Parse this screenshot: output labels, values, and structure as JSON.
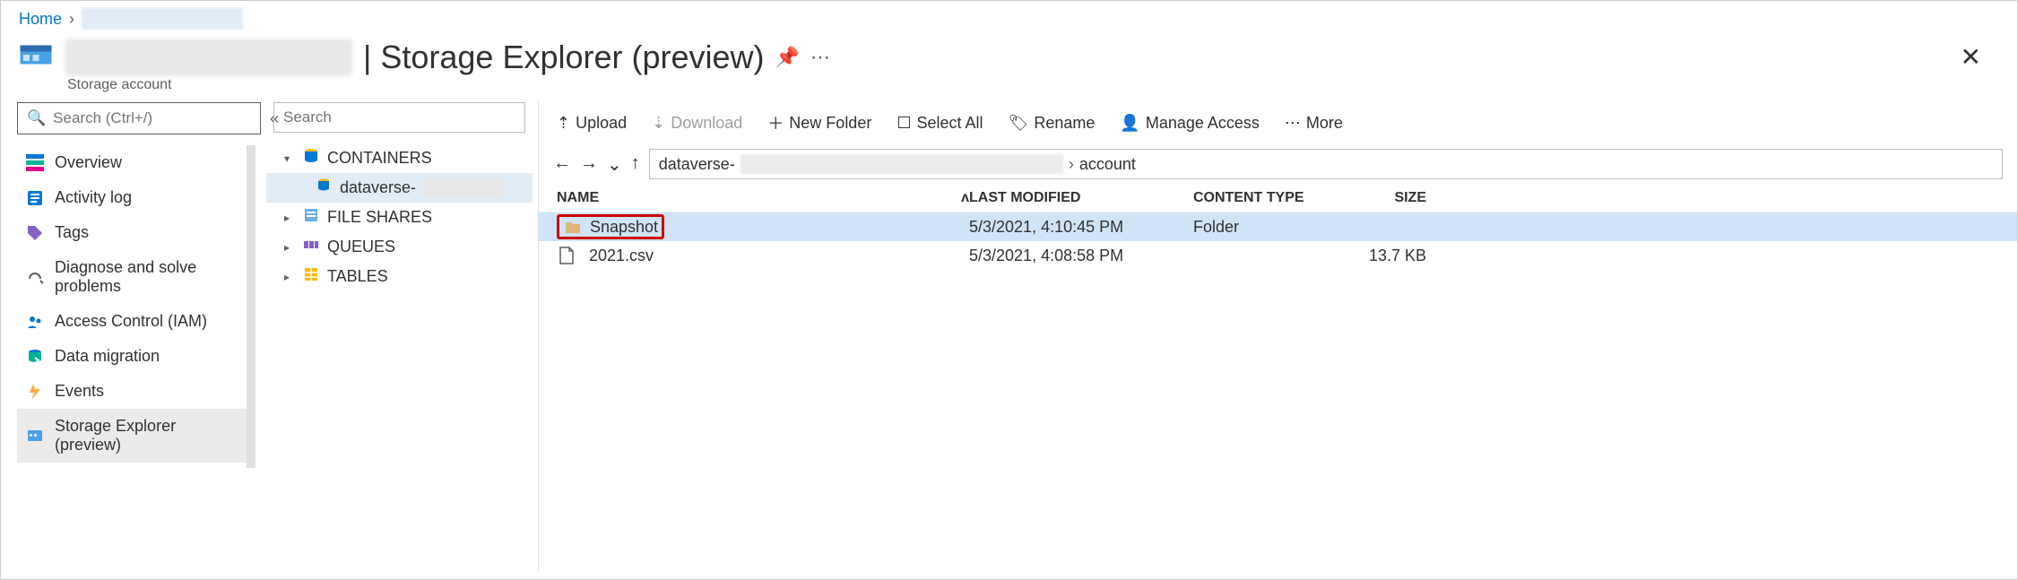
{
  "breadcrumb": {
    "home": "Home"
  },
  "header": {
    "title_suffix": "| Storage Explorer (preview)",
    "subtitle": "Storage account"
  },
  "search": {
    "placeholder": "Search (Ctrl+/)"
  },
  "sidebar": {
    "items": [
      {
        "label": "Overview"
      },
      {
        "label": "Activity log"
      },
      {
        "label": "Tags"
      },
      {
        "label": "Diagnose and solve problems"
      },
      {
        "label": "Access Control (IAM)"
      },
      {
        "label": "Data migration"
      },
      {
        "label": "Events"
      },
      {
        "label": "Storage Explorer (preview)"
      }
    ]
  },
  "tree": {
    "search_placeholder": "Search",
    "containers": "CONTAINERS",
    "container_item": "dataverse-",
    "file_shares": "FILE SHARES",
    "queues": "QUEUES",
    "tables": "TABLES"
  },
  "toolbar": {
    "upload": "Upload",
    "download": "Download",
    "new_folder": "New Folder",
    "select_all": "Select All",
    "rename": "Rename",
    "manage_access": "Manage Access",
    "more": "More"
  },
  "path": {
    "first": "dataverse-",
    "last": "account"
  },
  "columns": {
    "name": "NAME",
    "modified": "LAST MODIFIED",
    "content_type": "CONTENT TYPE",
    "size": "SIZE"
  },
  "files": [
    {
      "name": "Snapshot",
      "modified": "5/3/2021, 4:10:45 PM",
      "type": "Folder",
      "size": ""
    },
    {
      "name": "2021.csv",
      "modified": "5/3/2021, 4:08:58 PM",
      "type": "",
      "size": "13.7 KB"
    }
  ]
}
